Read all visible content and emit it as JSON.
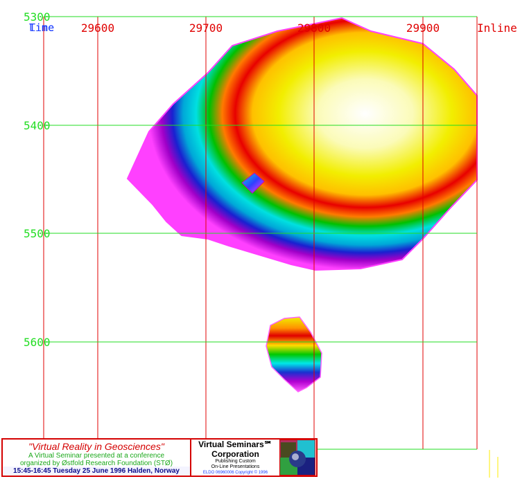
{
  "corner_labels": [
    "Time",
    "Line"
  ],
  "axes": {
    "x_axis_title": "Inline",
    "x_tick_labels": [
      "29600",
      "29700",
      "29800",
      "29900"
    ],
    "y_tick_labels": [
      "5300",
      "5400",
      "5500",
      "5600"
    ],
    "x_line_color": "#e00000",
    "y_line_color": "#22dd22"
  },
  "map_features": {
    "main_body": "color-contoured surface, white/yellow top grading through red, green, cyan, blue to magenta",
    "small_patch": "small diamond-shaped feature inside main body",
    "lower_body": "small elongated contoured body"
  },
  "banner": {
    "title": "\"Virtual Reality in Geosciences\"",
    "subtitle_1": "A Virtual Seminar presented at a conference",
    "subtitle_2": "organized by Østfold Research Foundation (STØ)",
    "time_line": "15:45-16:45 Tuesday 25 June 1996 Halden, Norway",
    "company_1": "Virtual Seminars℠",
    "company_2": "Corporation",
    "small_1": "Publishing Custom",
    "small_2": "On-Line Presentations",
    "copyright": "ELDO 06960006 Copyright © 1996",
    "colors": {
      "border": "#d40000",
      "title": "#d40000",
      "subtitle": "#1aa81a",
      "time": "#0a0a8a"
    }
  }
}
